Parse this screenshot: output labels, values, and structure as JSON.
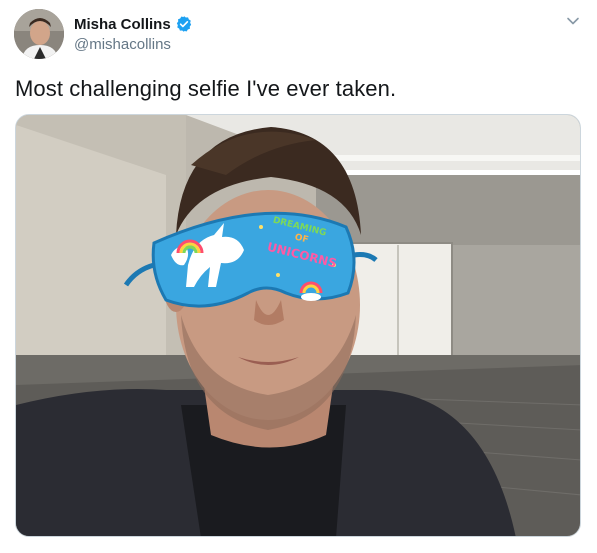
{
  "tweet": {
    "author": {
      "display_name": "Misha Collins",
      "handle": "@mishacollins",
      "verified": true,
      "avatar_icon": "user-avatar"
    },
    "text": "Most challenging selfie I've ever taken.",
    "menu_icon": "chevron-down-icon",
    "media": {
      "description_icon": "photo",
      "mask_text_line1": "DREAMING",
      "mask_text_line2": "OF",
      "mask_text_line3": "UNICORNS"
    }
  },
  "colors": {
    "verified_blue": "#1da1f2",
    "text_primary": "#14171a",
    "text_secondary": "#657786",
    "mask_blue": "#3aa6e0"
  }
}
